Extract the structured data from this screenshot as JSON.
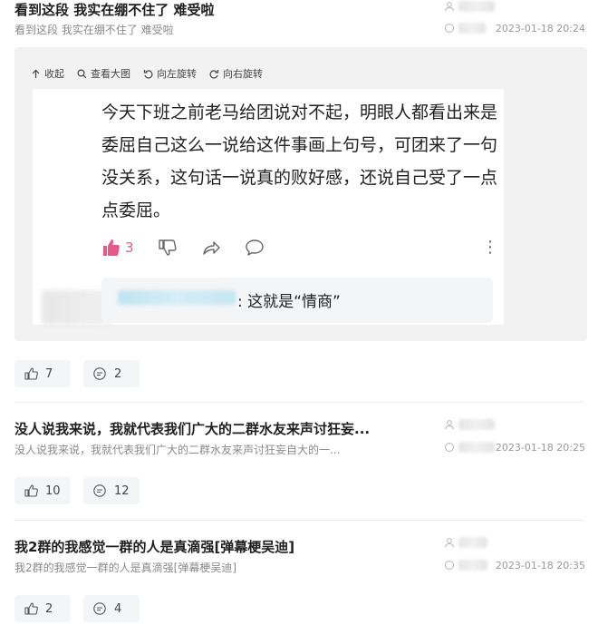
{
  "posts": [
    {
      "title": "看到这段 我实在绷不住了 难受啦",
      "summary": "看到这段 我实在绷不住了 难受啦",
      "time": "2023-01-18 20:24",
      "likes": "7",
      "comments": "2"
    },
    {
      "title": "没人说我来说，我就代表我们广大的二群水友来声讨狂妄...",
      "summary": "没人说我来说，我就代表我们广大的二群水友来声讨狂妄自大的一...",
      "time": "2023-01-18 20:25",
      "likes": "10",
      "comments": "12"
    },
    {
      "title": "我2群的我感觉一群的人是真滴强[弹幕梗吴迪]",
      "summary": "我2群的我感觉一群的人是真滴强[弹幕梗吴迪]",
      "time": "2023-01-18 20:35",
      "likes": "2",
      "comments": "4"
    }
  ],
  "viewer_toolbar": {
    "collapse": "收起",
    "view_large": "查看大图",
    "rotate_left": "向左旋转",
    "rotate_right": "向右旋转"
  },
  "embedded_comment": {
    "text": "今天下班之前老马给团说对不起，明眼人都看出来是委屈自己这么一说给这件事画上句号，可团来了一句没关系，这句话一说真的败好感，还说自己受了一点点委屈。",
    "like_count": "3",
    "reply_text": ": 这就是“情商”"
  },
  "colors": {
    "like_pink": "#e8598a",
    "viewer_bg": "#f2f2f2",
    "button_bg": "#f4f5f7"
  },
  "icons": [
    "user-icon",
    "comment-icon",
    "thumbs-up-icon",
    "thumbs-down-icon",
    "share-icon",
    "more-icon",
    "zoom-icon",
    "rotate-left-icon",
    "rotate-right-icon",
    "collapse-icon"
  ]
}
